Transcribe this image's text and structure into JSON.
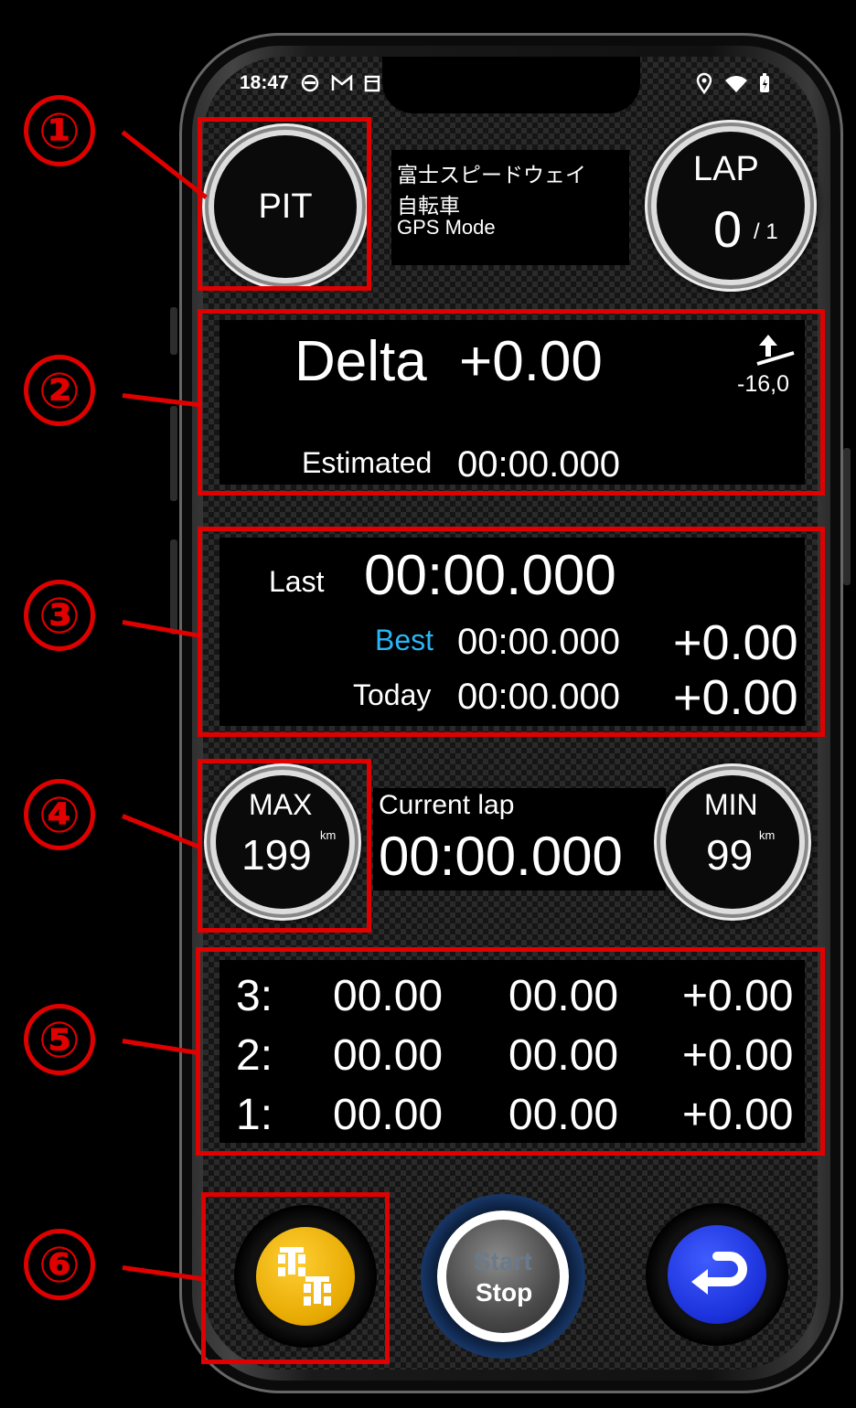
{
  "status": {
    "time": "18:47"
  },
  "header": {
    "pit_label": "PIT",
    "track_name": "富士スピードウェイ",
    "vehicle": "自転車",
    "mode": "GPS Mode",
    "lap_label": "LAP",
    "lap_current": "0",
    "lap_total": "/ 1"
  },
  "delta": {
    "label": "Delta",
    "value": "+0.00",
    "offset": "-16,0",
    "estimated_label": "Estimated",
    "estimated_time": "00:00.000"
  },
  "laps": {
    "last_label": "Last",
    "last_time": "00:00.000",
    "best_label": "Best",
    "best_time": "00:00.000",
    "best_diff": "+0.00",
    "today_label": "Today",
    "today_time": "00:00.000",
    "today_diff": "+0.00"
  },
  "speed": {
    "max_label": "MAX",
    "max_value": "199",
    "min_label": "MIN",
    "min_value": "99",
    "unit": "km",
    "current_lap_label": "Current lap",
    "current_lap_time": "00:00.000"
  },
  "sectors": [
    {
      "index": "3:",
      "a": "00.00",
      "b": "00.00",
      "diff": "+0.00"
    },
    {
      "index": "2:",
      "a": "00.00",
      "b": "00.00",
      "diff": "+0.00"
    },
    {
      "index": "1:",
      "a": "00.00",
      "b": "00.00",
      "diff": "+0.00"
    }
  ],
  "controls": {
    "start_label": "Start",
    "stop_label": "Stop"
  },
  "annotations": [
    "①",
    "②",
    "③",
    "④",
    "⑤",
    "⑥"
  ],
  "colors": {
    "accent_blue": "#29b6f6",
    "annotation_red": "#e00000",
    "car_button": "#e6a800",
    "back_button": "#1a2fd8"
  }
}
